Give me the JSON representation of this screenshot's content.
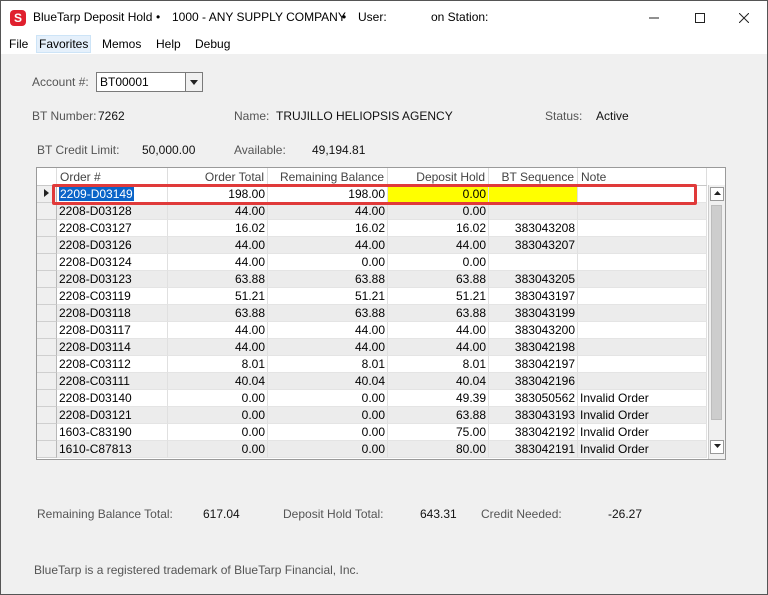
{
  "window": {
    "app_name": "BlueTarp Deposit Hold",
    "company": "1000 - ANY SUPPLY COMPANY",
    "user_label": "User:",
    "station_label": "on Station:",
    "separator": "•"
  },
  "menu": [
    "File",
    "Favorites",
    "Memos",
    "Help",
    "Debug"
  ],
  "account": {
    "label": "Account #:",
    "value": "BT00001"
  },
  "info": {
    "bt_number_label": "BT Number:",
    "bt_number": "7262",
    "name_label": "Name:",
    "name": "TRUJILLO HELIOPSIS AGENCY",
    "status_label": "Status:",
    "status": "Active",
    "credit_limit_label": "BT Credit Limit:",
    "credit_limit": "50,000.00",
    "available_label": "Available:",
    "available": "49,194.81"
  },
  "grid": {
    "columns": [
      "Order #",
      "Order Total",
      "Remaining Balance",
      "Deposit Hold",
      "BT Sequence",
      "Note"
    ],
    "rows": [
      [
        "2209-D03149",
        "198.00",
        "198.00",
        "0.00",
        "",
        ""
      ],
      [
        "2208-D03128",
        "44.00",
        "44.00",
        "0.00",
        "",
        ""
      ],
      [
        "2208-C03127",
        "16.02",
        "16.02",
        "16.02",
        "383043208",
        ""
      ],
      [
        "2208-D03126",
        "44.00",
        "44.00",
        "44.00",
        "383043207",
        ""
      ],
      [
        "2208-D03124",
        "44.00",
        "0.00",
        "0.00",
        "",
        ""
      ],
      [
        "2208-D03123",
        "63.88",
        "63.88",
        "63.88",
        "383043205",
        ""
      ],
      [
        "2208-C03119",
        "51.21",
        "51.21",
        "51.21",
        "383043197",
        ""
      ],
      [
        "2208-D03118",
        "63.88",
        "63.88",
        "63.88",
        "383043199",
        ""
      ],
      [
        "2208-D03117",
        "44.00",
        "44.00",
        "44.00",
        "383043200",
        ""
      ],
      [
        "2208-D03114",
        "44.00",
        "44.00",
        "44.00",
        "383042198",
        ""
      ],
      [
        "2208-C03112",
        "8.01",
        "8.01",
        "8.01",
        "383042197",
        ""
      ],
      [
        "2208-C03111",
        "40.04",
        "40.04",
        "40.04",
        "383042196",
        ""
      ],
      [
        "2208-D03140",
        "0.00",
        "0.00",
        "49.39",
        "383050562",
        "Invalid Order"
      ],
      [
        "2208-D03121",
        "0.00",
        "0.00",
        "63.88",
        "383043193",
        "Invalid Order"
      ],
      [
        "1603-C83190",
        "0.00",
        "0.00",
        "75.00",
        "383042192",
        "Invalid Order"
      ],
      [
        "1610-C87813",
        "0.00",
        "0.00",
        "80.00",
        "383042191",
        "Invalid Order"
      ]
    ]
  },
  "totals": {
    "remaining_label": "Remaining Balance Total:",
    "remaining": "617.04",
    "deposit_label": "Deposit Hold Total:",
    "deposit": "643.31",
    "credit_label": "Credit Needed:",
    "credit": "-26.27"
  },
  "footer": "BlueTarp is a registered trademark of BlueTarp Financial, Inc.",
  "colors": {
    "highlight": "#e03a3a",
    "deposit_edit": "#ffff00",
    "selection": "#0a64c8"
  }
}
